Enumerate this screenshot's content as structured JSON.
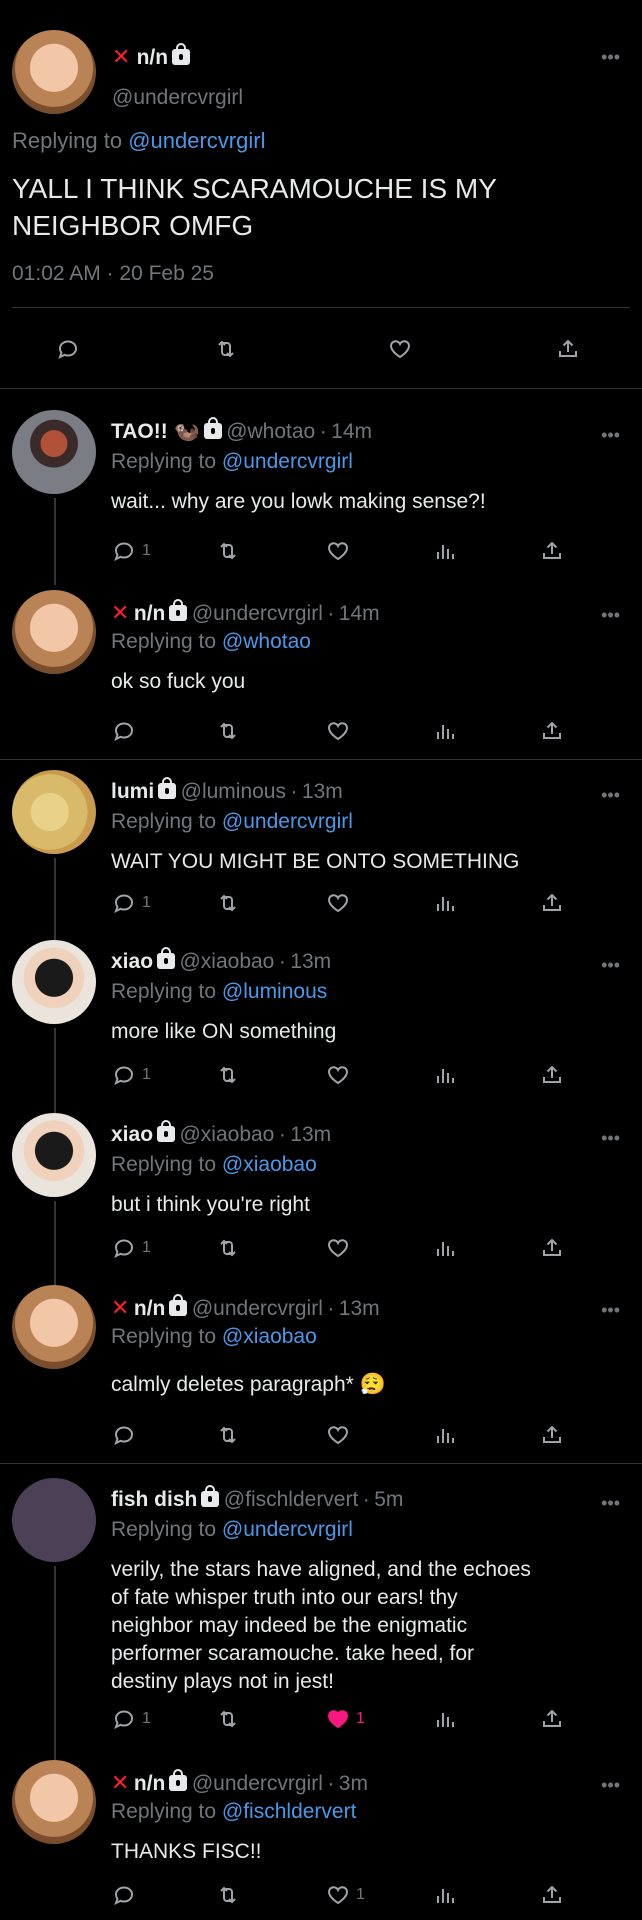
{
  "main": {
    "author_name": "n/n",
    "author_handle": "@undercvrgirl",
    "replying_prefix": "Replying to ",
    "replying_to": "@undercvrgirl",
    "text_line1": "YALL I THINK SCARAMOUCHE IS MY",
    "text_line2": "NEIGHBOR OMFG",
    "timestamp": "01:02 AM · 20 Feb 25",
    "more": "•••"
  },
  "replies": [
    {
      "name": "TAO!! 🦦",
      "handle": "@whotao",
      "time": "14m",
      "replying_prefix": "Replying to ",
      "replying_to": "@undercvrgirl",
      "text": "wait... why are you lowk making sense?!",
      "reply_count": "1",
      "like_count": ""
    },
    {
      "name": "n/n",
      "handle": "@undercvrgirl",
      "time": "14m",
      "replying_prefix": "Replying to ",
      "replying_to": "@whotao",
      "text": "ok so fuck you",
      "reply_count": "",
      "like_count": ""
    },
    {
      "name": "lumi",
      "handle": "@luminous",
      "time": "13m",
      "replying_prefix": "Replying to ",
      "replying_to": "@undercvrgirl",
      "text": "WAIT YOU MIGHT BE ONTO SOMETHING",
      "reply_count": "1",
      "like_count": ""
    },
    {
      "name": "xiao",
      "handle": "@xiaobao",
      "time": "13m",
      "replying_prefix": "Replying to ",
      "replying_to": "@luminous",
      "text": "more like ON something",
      "reply_count": "1",
      "like_count": ""
    },
    {
      "name": "xiao",
      "handle": "@xiaobao",
      "time": "13m",
      "replying_prefix": "Replying to ",
      "replying_to": "@xiaobao",
      "text": "but i think you're right",
      "reply_count": "1",
      "like_count": ""
    },
    {
      "name": "n/n",
      "handle": "@undercvrgirl",
      "time": "13m",
      "replying_prefix": "Replying to ",
      "replying_to": "@xiaobao",
      "text": "calmly deletes paragraph* 😮‍💨",
      "reply_count": "",
      "like_count": ""
    },
    {
      "name": "fish dish",
      "handle": "@fischldervert",
      "time": "5m",
      "replying_prefix": "Replying to ",
      "replying_to": "@undercvrgirl",
      "text_lines": [
        "verily, the stars have aligned, and the echoes",
        "of fate whisper truth into our ears! thy",
        "neighbor may indeed be the enigmatic",
        "performer scaramouche. take heed, for",
        "destiny plays not in jest!"
      ],
      "reply_count": "1",
      "like_count": "1"
    },
    {
      "name": "n/n",
      "handle": "@undercvrgirl",
      "time": "3m",
      "replying_prefix": "Replying to ",
      "replying_to": "@fischldervert",
      "text": "THANKS FISC!!",
      "reply_count": "",
      "like_count": "1"
    }
  ],
  "x_mark": "✕",
  "dot": "·",
  "colors": {
    "accent": "#4a99e9",
    "like_red": "#f91880",
    "x_red": "#f4212e",
    "text": "#e7e9ea",
    "muted": "#71767b"
  },
  "icons": [
    "reply-icon",
    "retweet-icon",
    "like-icon",
    "views-icon",
    "share-icon",
    "lock-icon",
    "more-icon"
  ]
}
